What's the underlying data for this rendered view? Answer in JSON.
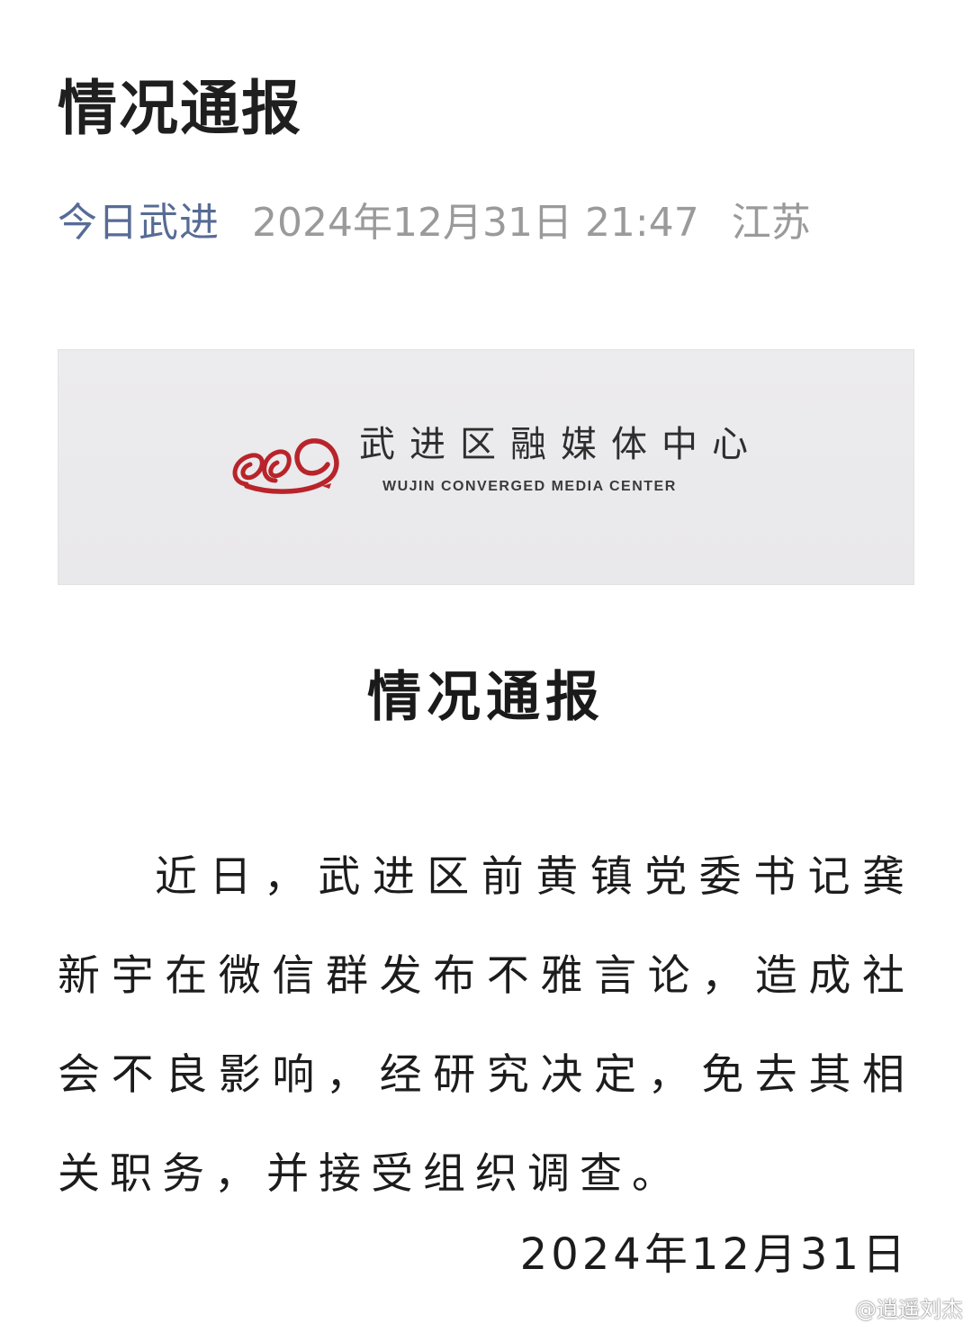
{
  "header": {
    "title": "情况通报",
    "account": "今日武进",
    "datetime": "2024年12月31日 21:47",
    "region": "江苏"
  },
  "banner": {
    "cn_name": "武进区融媒体中心",
    "en_name": "WUJIN CONVERGED MEDIA CENTER",
    "emblem_color": "#b8242a"
  },
  "notice": {
    "title": "情况通报",
    "body": "近日，武进区前黄镇党委书记龚新宇在微信群发布不雅言论，造成社会不良影响，经研究决定，免去其相关职务，并接受组织调查。",
    "date": "2024年12月31日"
  },
  "watermark": {
    "text": "@逍遥刘杰",
    "icon": "weibo-icon"
  }
}
